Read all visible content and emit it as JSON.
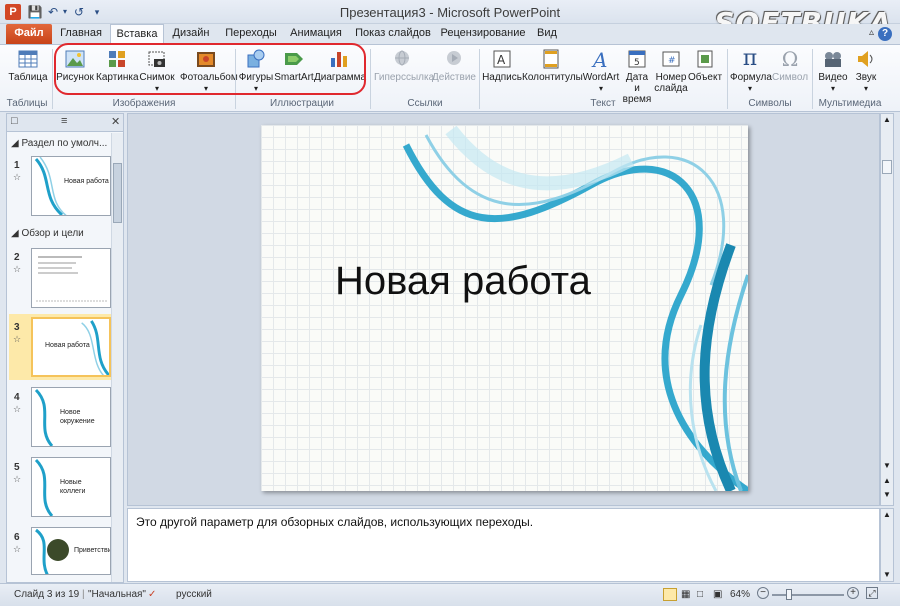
{
  "titlebar": {
    "app_icon": "P",
    "title": "Презентация3  -  Microsoft PowerPoint",
    "watermark": "SOFTBUKA"
  },
  "quick_access": {
    "save_icon": "save-icon",
    "undo_icon": "undo-icon",
    "redo_icon": "redo-icon",
    "customize_icon": "chevron-down-icon"
  },
  "tabs": {
    "file": "Файл",
    "home": "Главная",
    "insert": "Вставка",
    "design": "Дизайн",
    "transitions": "Переходы",
    "animation": "Анимация",
    "slideshow": "Показ слайдов",
    "review": "Рецензирование",
    "view": "Вид"
  },
  "ribbon": {
    "table": "Таблица",
    "picture": "Рисунок",
    "clipart": "Картинка",
    "screenshot": "Снимок",
    "photoalbum": "Фотоальбом",
    "shapes": "Фигуры",
    "smartart": "SmartArt",
    "chart": "Диаграмма",
    "hyperlink": "Гиперссылка",
    "action": "Действие",
    "textbox": "Надпись",
    "header_footer": "Колонтитулы",
    "wordart": "WordArt",
    "datetime": "Дата и время",
    "slide_number": "Номер слайда",
    "object": "Объект",
    "equation": "Формула",
    "symbol": "Символ",
    "video": "Видео",
    "audio": "Звук",
    "groups": {
      "tables": "Таблицы",
      "images": "Изображения",
      "illustrations": "Иллюстрации",
      "links": "Ссылки",
      "text": "Текст",
      "symbols": "Символы",
      "media": "Мультимедиа"
    }
  },
  "slides_panel": {
    "section1": "Раздел по умолч...",
    "section2": "Обзор и цели",
    "slides": [
      {
        "num": "1",
        "text": "Новая работа"
      },
      {
        "num": "2",
        "text": ""
      },
      {
        "num": "3",
        "text": "Новая работа"
      },
      {
        "num": "4",
        "text": "Новое окружение"
      },
      {
        "num": "5",
        "text": "Новые коллеги"
      },
      {
        "num": "6",
        "text": "Приветствие"
      }
    ]
  },
  "slide": {
    "title": "Новая работа"
  },
  "notes": {
    "text": "Это другой параметр для обзорных слайдов, использующих переходы."
  },
  "status": {
    "slide_info": "Слайд 3 из 19",
    "theme": "\"Начальная\"",
    "language": "русский",
    "zoom": "64%"
  },
  "colors": {
    "file_tab": "#d24726",
    "accent": "#1fa0c9",
    "highlight": "#e0282e",
    "selected_thumb": "#fde9a9"
  }
}
